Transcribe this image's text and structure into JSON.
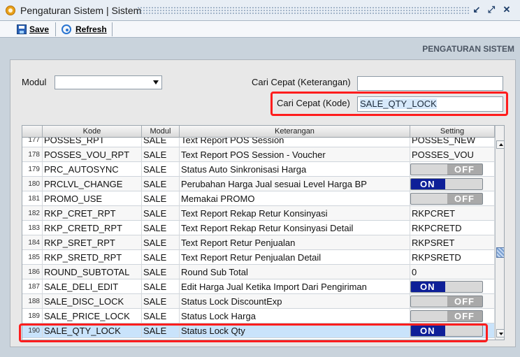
{
  "window": {
    "title": "Pengaturan Sistem | Sistem",
    "controls": {
      "restore": "↙",
      "maximize": "⤢",
      "close": "✕"
    }
  },
  "toolbar": {
    "save_label": "Save",
    "refresh_label": "Refresh"
  },
  "section_title": "PENGATURAN SISTEM",
  "filters": {
    "module_label": "Modul",
    "module_value": "",
    "quick_search_description_label": "Cari Cepat (Keterangan)",
    "quick_search_description_value": "",
    "quick_search_code_label": "Cari Cepat (Kode)",
    "quick_search_code_value": "SALE_QTY_LOCK"
  },
  "table": {
    "headers": {
      "kode": "Kode",
      "modul": "Modul",
      "keterangan": "Keterangan",
      "setting": "Setting"
    },
    "rows": [
      {
        "no": "177",
        "kode": "POSSES_RPT",
        "modul": "SALE",
        "keterangan": "Text Report POS Session",
        "setting_type": "text",
        "setting": "POSSES_NEW"
      },
      {
        "no": "178",
        "kode": "POSSES_VOU_RPT",
        "modul": "SALE",
        "keterangan": "Text Report POS Session - Voucher",
        "setting_type": "text",
        "setting": "POSSES_VOU"
      },
      {
        "no": "179",
        "kode": "PRC_AUTOSYNC",
        "modul": "SALE",
        "keterangan": "Status Auto Sinkronisasi Harga",
        "setting_type": "toggle",
        "setting": "OFF"
      },
      {
        "no": "180",
        "kode": "PRCLVL_CHANGE",
        "modul": "SALE",
        "keterangan": "Perubahan Harga Jual sesuai Level Harga BP",
        "setting_type": "toggle",
        "setting": "ON"
      },
      {
        "no": "181",
        "kode": "PROMO_USE",
        "modul": "SALE",
        "keterangan": "Memakai PROMO",
        "setting_type": "toggle",
        "setting": "OFF"
      },
      {
        "no": "182",
        "kode": "RKP_CRET_RPT",
        "modul": "SALE",
        "keterangan": "Text Report Rekap Retur Konsinyasi",
        "setting_type": "text",
        "setting": "RKPCRET"
      },
      {
        "no": "183",
        "kode": "RKP_CRETD_RPT",
        "modul": "SALE",
        "keterangan": "Text Report Rekap Retur Konsinyasi Detail",
        "setting_type": "text",
        "setting": "RKPCRETD"
      },
      {
        "no": "184",
        "kode": "RKP_SRET_RPT",
        "modul": "SALE",
        "keterangan": "Text Report Retur Penjualan",
        "setting_type": "text",
        "setting": "RKPSRET"
      },
      {
        "no": "185",
        "kode": "RKP_SRETD_RPT",
        "modul": "SALE",
        "keterangan": "Text Report Retur Penjualan Detail",
        "setting_type": "text",
        "setting": "RKPSRETD"
      },
      {
        "no": "186",
        "kode": "ROUND_SUBTOTAL",
        "modul": "SALE",
        "keterangan": "Round Sub Total",
        "setting_type": "text",
        "setting": "0"
      },
      {
        "no": "187",
        "kode": "SALE_DELI_EDIT",
        "modul": "SALE",
        "keterangan": "Edit Harga Jual Ketika Import Dari Pengiriman",
        "setting_type": "toggle",
        "setting": "ON"
      },
      {
        "no": "188",
        "kode": "SALE_DISC_LOCK",
        "modul": "SALE",
        "keterangan": "Status Lock DiscountExp",
        "setting_type": "toggle",
        "setting": "OFF"
      },
      {
        "no": "189",
        "kode": "SALE_PRICE_LOCK",
        "modul": "SALE",
        "keterangan": "Status Lock Harga",
        "setting_type": "toggle",
        "setting": "OFF"
      },
      {
        "no": "190",
        "kode": "SALE_QTY_LOCK",
        "modul": "SALE",
        "keterangan": "Status Lock Qty",
        "setting_type": "toggle",
        "setting": "ON",
        "selected": true
      }
    ]
  },
  "colors": {
    "highlight": "#ff1d1d",
    "toggle_on": "#0e1f98",
    "toggle_off": "#a9a9a9"
  }
}
